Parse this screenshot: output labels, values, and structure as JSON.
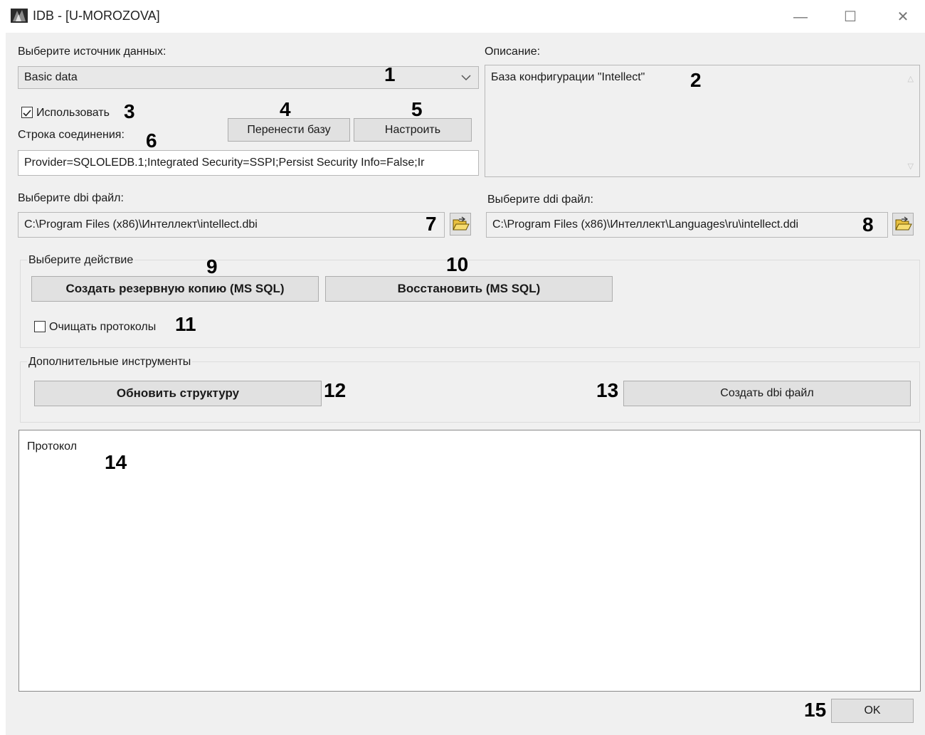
{
  "window": {
    "title": "IDB - [U-MOROZOVA]"
  },
  "datasource": {
    "label": "Выберите источник данных:",
    "selected": "Basic data"
  },
  "description": {
    "label": "Описание:",
    "text": "База конфигурации \"Intellect\""
  },
  "use_checkbox": {
    "label": "Использовать",
    "checked": true
  },
  "buttons": {
    "transfer": "Перенести базу",
    "configure": "Настроить",
    "backup": "Создать резервную копию  (MS SQL)",
    "restore": "Восстановить (MS SQL)",
    "update_structure": "Обновить структуру",
    "create_dbi": "Создать dbi файл",
    "ok": "OK"
  },
  "connection": {
    "label": "Строка соединения:",
    "value": "Provider=SQLOLEDB.1;Integrated Security=SSPI;Persist Security Info=False;Ir"
  },
  "dbi": {
    "label": "Выберите dbi файл:",
    "value": "C:\\Program Files (x86)\\Интеллект\\intellect.dbi"
  },
  "ddi": {
    "label": "Выберите ddi файл:",
    "value": "C:\\Program Files (x86)\\Интеллект\\Languages\\ru\\intellect.ddi"
  },
  "action_group": {
    "label": "Выберите действие"
  },
  "clear_logs": {
    "label": "Очищать протоколы",
    "checked": false
  },
  "tools_group": {
    "label": "Дополнительные инструменты"
  },
  "log": {
    "text": "Протокол"
  },
  "markers": {
    "m1": "1",
    "m2": "2",
    "m3": "3",
    "m4": "4",
    "m5": "5",
    "m6": "6",
    "m7": "7",
    "m8": "8",
    "m9": "9",
    "m10": "10",
    "m11": "11",
    "m12": "12",
    "m13": "13",
    "m14": "14",
    "m15": "15"
  },
  "icons": {
    "app": "app-icon",
    "minimize": "minimize-icon",
    "maximize": "maximize-icon",
    "close": "close-icon",
    "dropdown": "chevron-down-icon",
    "folder": "folder-open-icon"
  },
  "colors": {
    "window_bg": "#f0f0f0",
    "button_bg": "#e1e1e1",
    "border": "#adadad"
  }
}
